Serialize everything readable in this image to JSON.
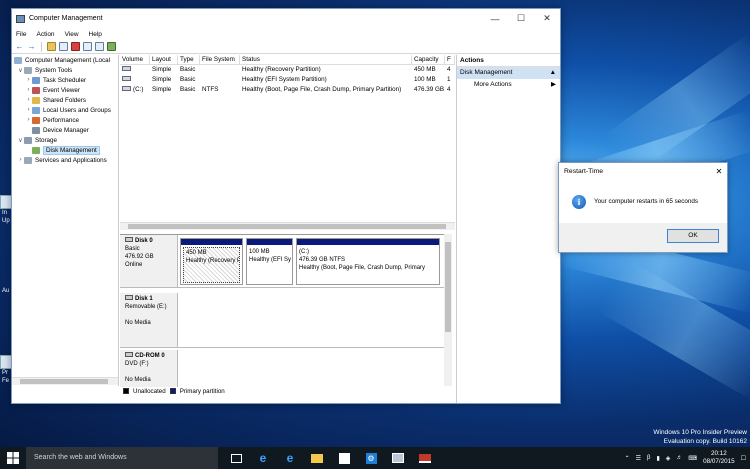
{
  "window": {
    "title": "Computer Management",
    "menu": [
      "File",
      "Action",
      "View",
      "Help"
    ]
  },
  "tree": {
    "root": "Computer Management (Local",
    "items": [
      {
        "label": "System Tools",
        "level": 1,
        "expanded": true
      },
      {
        "label": "Task Scheduler",
        "level": 2
      },
      {
        "label": "Event Viewer",
        "level": 2
      },
      {
        "label": "Shared Folders",
        "level": 2
      },
      {
        "label": "Local Users and Groups",
        "level": 2
      },
      {
        "label": "Performance",
        "level": 2
      },
      {
        "label": "Device Manager",
        "level": 2
      },
      {
        "label": "Storage",
        "level": 1,
        "expanded": true
      },
      {
        "label": "Disk Management",
        "level": 2,
        "selected": true
      },
      {
        "label": "Services and Applications",
        "level": 1
      }
    ]
  },
  "volumes": {
    "headers": [
      "Volume",
      "Layout",
      "Type",
      "File System",
      "Status",
      "Capacity",
      "F"
    ],
    "rows": [
      [
        "",
        "Simple",
        "Basic",
        "",
        "Healthy (Recovery Partition)",
        "450 MB",
        "4"
      ],
      [
        "",
        "Simple",
        "Basic",
        "",
        "Healthy (EFI System Partition)",
        "100 MB",
        "1"
      ],
      [
        "(C:)",
        "Simple",
        "Basic",
        "NTFS",
        "Healthy (Boot, Page File, Crash Dump, Primary Partition)",
        "476.39 GB",
        "4"
      ]
    ]
  },
  "disks": [
    {
      "name": "Disk 0",
      "type": "Basic",
      "size": "476.92 GB",
      "status": "Online",
      "partitions": [
        {
          "title": "",
          "size": "450 MB",
          "status": "Healthy (Recovery P"
        },
        {
          "title": "",
          "size": "100 MB",
          "status": "Healthy (EFI Sy"
        },
        {
          "title": "(C:)",
          "size": "476.39 GB NTFS",
          "status": "Healthy (Boot, Page File, Crash Dump, Primary"
        }
      ]
    },
    {
      "name": "Disk 1",
      "type": "Removable (E:)",
      "size": "",
      "status": "No Media"
    },
    {
      "name": "CD-ROM 0",
      "type": "DVD (F:)",
      "size": "",
      "status": "No Media"
    }
  ],
  "legend": [
    "Unallocated",
    "Primary partition"
  ],
  "actions": {
    "header": "Actions",
    "selected": "Disk Management",
    "items": [
      "More Actions"
    ]
  },
  "dialog": {
    "title": "Restart-Time",
    "message": "Your computer restarts in 65 seconds",
    "ok": "OK"
  },
  "desktop_labels": [
    "In",
    "Up",
    "Au",
    "Pr",
    "Fe"
  ],
  "taskbar": {
    "search_placeholder": "Search the web and Windows",
    "time": "20:12",
    "date": "08/07/2015"
  },
  "watermark": {
    "line1": "Windows 10 Pro Insider Preview",
    "line2": "Evaluation copy. Build 10162"
  }
}
